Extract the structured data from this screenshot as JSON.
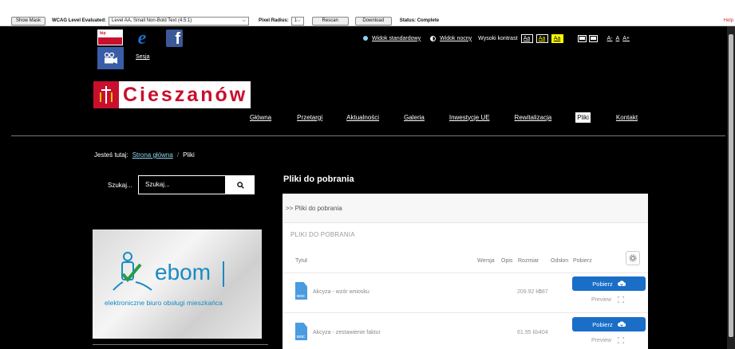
{
  "wcag": {
    "show_mask": "Show Mask",
    "level_label": "WCAG Level Evaluated:",
    "level_value": "Level AA, Small Non-Bold Text (4.5:1)",
    "radius_label": "Pixel Radius:",
    "radius_value": "1",
    "rescan": "Rescan",
    "download": "Download",
    "status": "Status: Complete",
    "help": "Help"
  },
  "header": {
    "bip_text": "bip",
    "sesja": "Sesja",
    "view_standard": "Widok standardowy",
    "view_night": "Widok nocny",
    "high_contrast_label": "Wysoki kontrast",
    "contrast_options": [
      "Aa",
      "Aa",
      "Aa"
    ],
    "font_sizes": [
      "A-",
      "A",
      "A+"
    ],
    "city_name": "Cieszanów"
  },
  "nav": {
    "items": [
      "Główna",
      "Przetargi",
      "Aktualności",
      "Galeria",
      "Inwestycje UE",
      "Rewitalizacja",
      "Pliki",
      "Kontakt"
    ],
    "active": "Pliki"
  },
  "breadcrumb": {
    "prefix": "Jesteś tutaj:",
    "home": "Strona główna",
    "separator": "/",
    "current": "Pliki"
  },
  "search": {
    "label": "Szukaj...",
    "placeholder": "Szukaj..."
  },
  "banner": {
    "word": "ebom",
    "subtitle": "elektroniczne biuro obsługi mieszkańca"
  },
  "main": {
    "title": "Pliki do pobrania",
    "panel_heading": ">> Pliki do pobrania",
    "section_label": "PLIKI DO POBRANIA",
    "columns": [
      "Tytuł",
      "Wersja",
      "Opis",
      "Rozmiar",
      "Odsłon",
      "Pobierz"
    ],
    "files": [
      {
        "icon": "DOC",
        "name": "Akcyza - wzór wniosku",
        "size": "209.92 kb",
        "views": "687",
        "download_label": "Pobierz",
        "preview_label": "Preview"
      },
      {
        "icon": "DOC",
        "name": "Akcyza - zestawienie faktur",
        "size": "61.95 kb",
        "views": "404",
        "download_label": "Pobierz",
        "preview_label": "Preview"
      }
    ]
  },
  "colors": {
    "accent": "#1a6ec8",
    "brand_red": "#c8102e",
    "link_blue": "#8fd3ef"
  }
}
